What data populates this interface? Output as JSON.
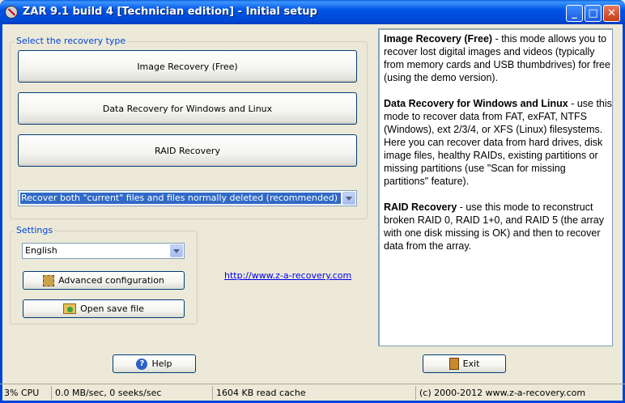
{
  "window": {
    "title": "ZAR 9.1 build 4 [Technician edition] - Initial setup",
    "minimize_glyph": "_",
    "maximize_glyph": "□",
    "close_glyph": "✕"
  },
  "recovery": {
    "group_label": "Select the recovery type",
    "image_recovery_label": "Image Recovery (Free)",
    "data_recovery_label": "Data Recovery for Windows and Linux",
    "raid_recovery_label": "RAID Recovery",
    "mode_select_value": "Recover both \"current\" files and files normally deleted (recommended)"
  },
  "settings": {
    "group_label": "Settings",
    "language_value": "English",
    "advanced_config_label": "Advanced configuration",
    "open_save_label": "Open save file"
  },
  "link": "http://www.z-a-recovery.com",
  "info": {
    "image_title": "Image Recovery (Free)",
    "image_text": " - this mode allows you to recover lost digital images and videos (typically from memory cards and USB thumbdrives) for free (using the demo version).",
    "data_title": "Data Recovery for Windows and Linux",
    "data_text": " - use this mode to recover data from FAT, exFAT, NTFS (Windows), ext 2/3/4, or XFS (Linux) filesystems. Here you can recover data from hard drives, disk image files, healthy RAIDs, existing partitions or missing partitions (use \"Scan for missing partitions\" feature).",
    "raid_title": "RAID Recovery",
    "raid_text": " - use this mode to reconstruct broken RAID 0, RAID 1+0, and RAID 5 (the array with one disk missing is OK) and then to recover data from the array."
  },
  "buttons": {
    "help_label": "Help",
    "help_glyph": "?",
    "exit_label": "Exit"
  },
  "status": {
    "cpu": "3% CPU",
    "speed": "0.0 MB/sec, 0 seeks/sec",
    "cache": "1604 KB read cache",
    "copyright": "(c) 2000-2012 www.z-a-recovery.com"
  },
  "icons": {
    "app": "zar-app-icon",
    "advanced": "chip-icon",
    "open_save": "folder-icon",
    "help": "help-icon",
    "exit": "exit-door-icon",
    "dropdown": "chevron-down-icon"
  }
}
